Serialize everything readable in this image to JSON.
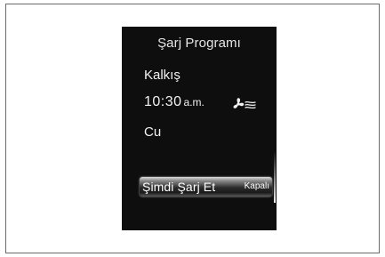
{
  "screen": {
    "title": "Şarj Programı",
    "departure_label": "Kalkış",
    "time": "10:30",
    "time_suffix": "a.m.",
    "climate_icon": "fan-airflow-icon",
    "day": "Cu",
    "charge_now_label": "Şimdi Şarj Et",
    "charge_now_status": "Kapalı"
  }
}
